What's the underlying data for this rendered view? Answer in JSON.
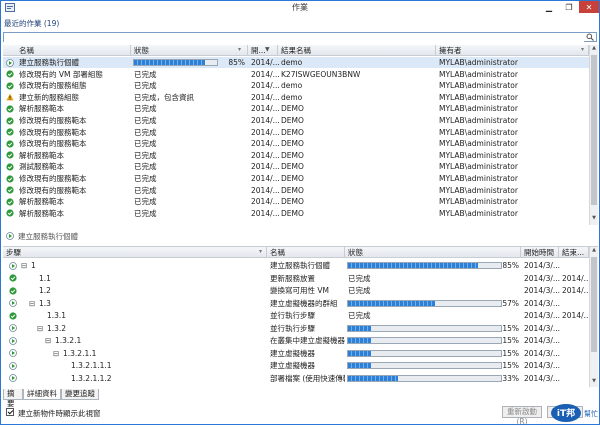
{
  "window": {
    "title": "作業"
  },
  "recent": {
    "heading": "最近的作業 (19)"
  },
  "search": {
    "placeholder": ""
  },
  "jobs_table": {
    "columns": [
      "名稱",
      "狀態",
      "開...",
      "結果名稱",
      "擁有者"
    ],
    "rows": [
      {
        "icon": "running",
        "name": "建立服務執行個體",
        "status": "",
        "progress": 85,
        "progress_text": "85%",
        "start": "2014/...",
        "result": "demo",
        "owner": "MYLAB\\administrator",
        "selected": true
      },
      {
        "icon": "ok",
        "name": "修改現有的 VM 部署組態",
        "status": "已完成",
        "start": "2014/...",
        "result": "K27ISWGEOUN3BNW",
        "owner": "MYLAB\\administrator"
      },
      {
        "icon": "ok",
        "name": "修改現有的服務組態",
        "status": "已完成",
        "start": "2014/...",
        "result": "demo",
        "owner": "MYLAB\\administrator"
      },
      {
        "icon": "warn",
        "name": "建立新的服務組態",
        "status": "已完成，包含資訊",
        "start": "2014/...",
        "result": "demo",
        "owner": "MYLAB\\administrator"
      },
      {
        "icon": "ok",
        "name": "解析服務範本",
        "status": "已完成",
        "start": "2014/...",
        "result": "DEMO",
        "owner": "MYLAB\\administrator"
      },
      {
        "icon": "ok",
        "name": "修改現有的服務範本",
        "status": "已完成",
        "start": "2014/...",
        "result": "DEMO",
        "owner": "MYLAB\\administrator"
      },
      {
        "icon": "ok",
        "name": "修改現有的服務範本",
        "status": "已完成",
        "start": "2014/...",
        "result": "DEMO",
        "owner": "MYLAB\\administrator"
      },
      {
        "icon": "ok",
        "name": "修改現有的服務範本",
        "status": "已完成",
        "start": "2014/...",
        "result": "DEMO",
        "owner": "MYLAB\\administrator"
      },
      {
        "icon": "ok",
        "name": "解析服務範本",
        "status": "已完成",
        "start": "2014/...",
        "result": "DEMO",
        "owner": "MYLAB\\administrator"
      },
      {
        "icon": "ok",
        "name": "測試服務範本",
        "status": "已完成",
        "start": "2014/...",
        "result": "DEMO",
        "owner": "MYLAB\\administrator"
      },
      {
        "icon": "ok",
        "name": "修改現有的服務範本",
        "status": "已完成",
        "start": "2014/...",
        "result": "DEMO",
        "owner": "MYLAB\\administrator"
      },
      {
        "icon": "ok",
        "name": "修改現有的服務範本",
        "status": "已完成",
        "start": "2014/...",
        "result": "DEMO",
        "owner": "MYLAB\\administrator"
      },
      {
        "icon": "ok",
        "name": "解析服務範本",
        "status": "已完成",
        "start": "2014/...",
        "result": "DEMO",
        "owner": "MYLAB\\administrator"
      },
      {
        "icon": "ok",
        "name": "解析服務範本",
        "status": "已完成",
        "start": "2014/...",
        "result": "DEMO",
        "owner": "MYLAB\\administrator"
      }
    ]
  },
  "detail": {
    "heading": "建立服務執行個體"
  },
  "steps_table": {
    "columns": [
      "步驟",
      "名稱",
      "狀態",
      "開始時間",
      "結束..."
    ],
    "rows": [
      {
        "icon": "running",
        "expander": "⊟",
        "step": "1",
        "depth": 0,
        "name": "建立服務執行個體",
        "status": "",
        "progress": 85,
        "progress_text": "85%",
        "start": "2014/3/...",
        "end": ""
      },
      {
        "icon": "ok",
        "expander": "",
        "step": "1.1",
        "depth": 1,
        "name": "更新服務放置",
        "status": "已完成",
        "start": "2014/3/...",
        "end": "2014/..."
      },
      {
        "icon": "ok",
        "expander": "",
        "step": "1.2",
        "depth": 1,
        "name": "變換寫可用性 VM",
        "status": "已完成",
        "start": "2014/3/...",
        "end": "2014/..."
      },
      {
        "icon": "running",
        "expander": "⊟",
        "step": "1.3",
        "depth": 1,
        "name": "建立虛擬機器的群組",
        "status": "",
        "progress": 57,
        "progress_text": "57%",
        "start": "2014/3/...",
        "end": ""
      },
      {
        "icon": "ok",
        "expander": "",
        "step": "1.3.1",
        "depth": 2,
        "name": "並行執行步驟",
        "status": "已完成",
        "start": "2014/3/...",
        "end": "2014/..."
      },
      {
        "icon": "running",
        "expander": "⊟",
        "step": "1.3.2",
        "depth": 2,
        "name": "並行執行步驟",
        "status": "",
        "progress": 15,
        "progress_text": "15%",
        "start": "2014/3/...",
        "end": ""
      },
      {
        "icon": "running",
        "expander": "⊟",
        "step": "1.3.2.1",
        "depth": 3,
        "name": "在叢集中建立虛擬機器",
        "status": "",
        "progress": 15,
        "progress_text": "15%",
        "start": "2014/3/...",
        "end": ""
      },
      {
        "icon": "running",
        "expander": "⊟",
        "step": "1.3.2.1.1",
        "depth": 4,
        "name": "建立虛擬機器",
        "status": "",
        "progress": 15,
        "progress_text": "15%",
        "start": "2014/3/...",
        "end": ""
      },
      {
        "icon": "running",
        "expander": "",
        "step": "1.3.2.1.1.1",
        "depth": 5,
        "name": "建立虛擬機器",
        "status": "",
        "progress": 15,
        "progress_text": "15%",
        "start": "2014/3/...",
        "end": ""
      },
      {
        "icon": "running",
        "expander": "",
        "step": "1.3.2.1.1.2",
        "depth": 5,
        "name": "部署檔案 (使用快速傳輸)",
        "status": "",
        "progress": 33,
        "progress_text": "33%",
        "start": "2014/3/...",
        "end": ""
      }
    ]
  },
  "tabs": [
    {
      "label": "摘要",
      "active": false
    },
    {
      "label": "詳細資料",
      "active": true
    },
    {
      "label": "變更追蹤",
      "active": false
    }
  ],
  "footer": {
    "checkbox_label": "建立新物件時顯示此視窗",
    "checked": true,
    "restart_label": "重新啟動(R)",
    "cancel_label": "取消(C)",
    "logo_text": "iT邦",
    "logo_sub": "幫忙"
  },
  "colors": {
    "accent": "#2b78d4",
    "ok": "#2e9a3a",
    "warn": "#e8a40c",
    "progress": "#2e7fd6"
  }
}
